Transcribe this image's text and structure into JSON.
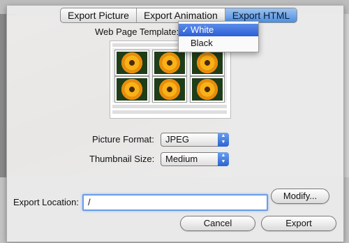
{
  "tabs": [
    {
      "label": "Export Picture"
    },
    {
      "label": "Export Animation"
    },
    {
      "label": "Export HTML"
    }
  ],
  "template": {
    "label": "Web Page Template:",
    "options": [
      {
        "label": "White",
        "check": "✓",
        "selected": true
      },
      {
        "label": "Black",
        "selected": false
      }
    ]
  },
  "picture_format": {
    "label": "Picture Format:",
    "value": "JPEG"
  },
  "thumbnail_size": {
    "label": "Thumbnail Size:",
    "value": "Medium"
  },
  "export_location": {
    "label": "Export Location:",
    "value": "/"
  },
  "buttons": {
    "modify": "Modify...",
    "cancel": "Cancel",
    "export": "Export"
  },
  "colors": {
    "accent": "#3a74dc",
    "tab_active": "#6ea6ea"
  },
  "icons": {
    "select_arrows": "up-down-arrows-icon"
  }
}
